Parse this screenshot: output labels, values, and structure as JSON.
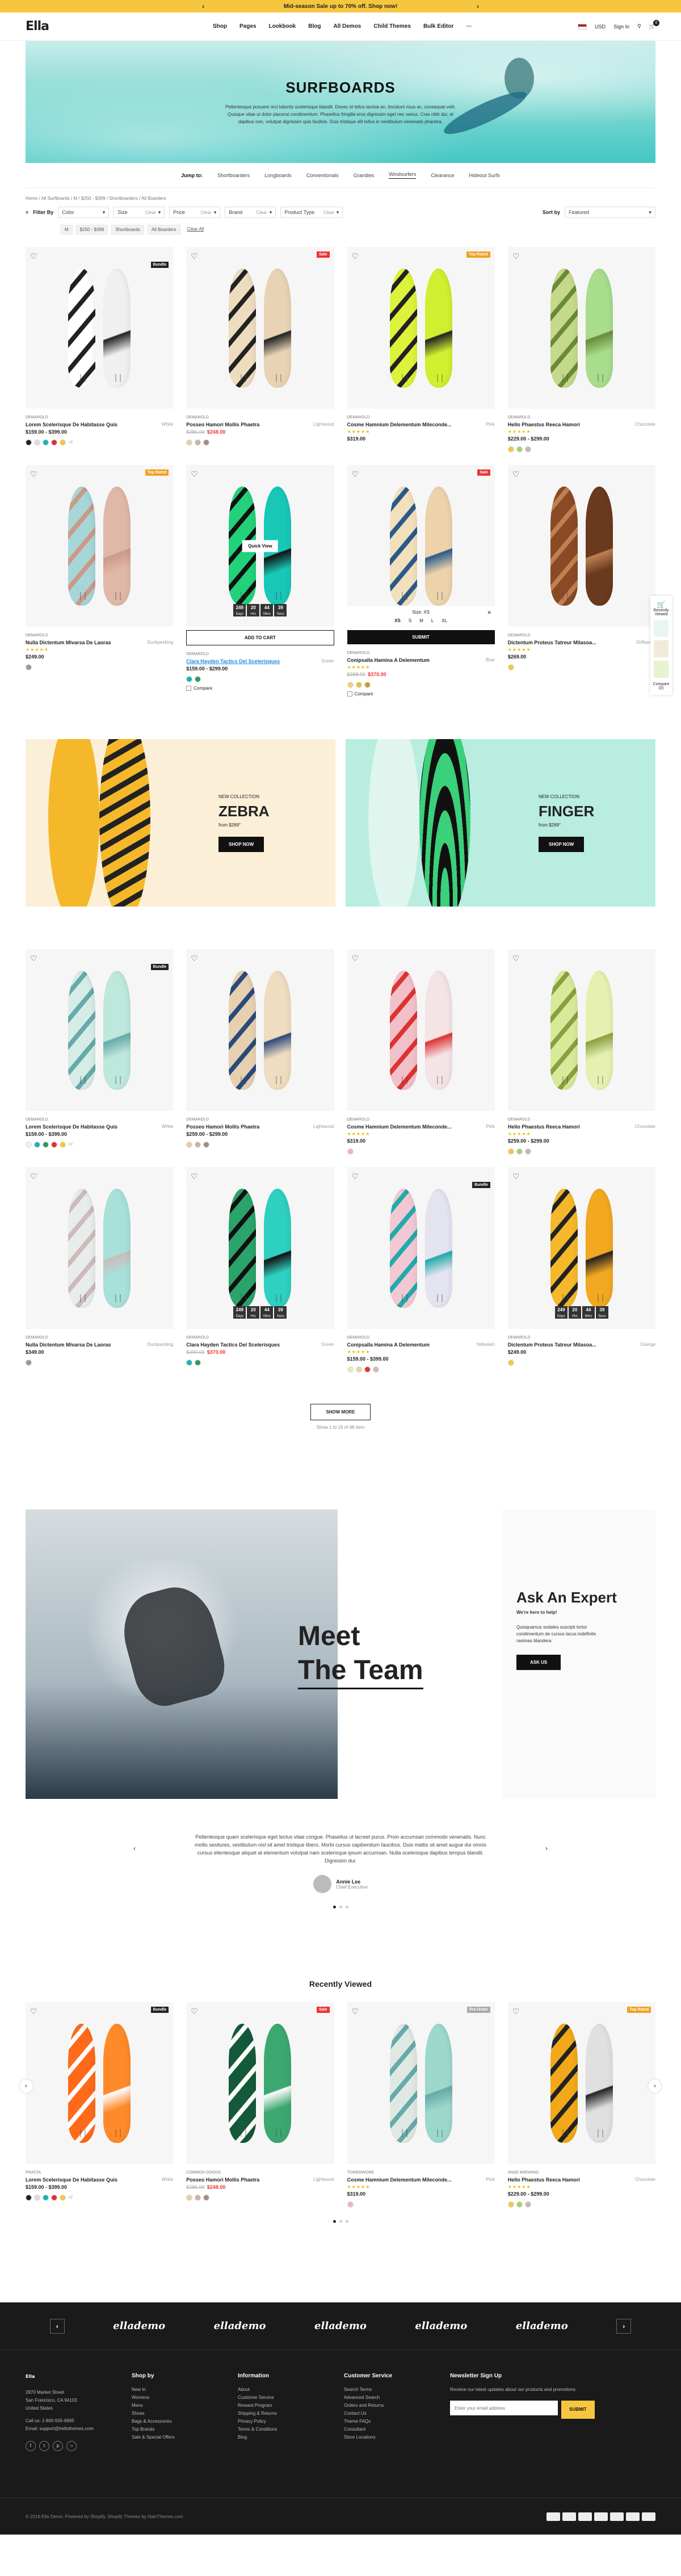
{
  "announcement": {
    "text": "Mid-season Sale up to 70% off. Shop now!"
  },
  "header": {
    "logo": "Ella",
    "nav": [
      "Shop",
      "Pages",
      "Lookbook",
      "Blog",
      "All Demos",
      "Child Themes",
      "Bulk Editor",
      "⋯"
    ],
    "currency": "USD",
    "signin": "Sign In",
    "cart_count": "0"
  },
  "hero": {
    "title": "SURFBOARDS",
    "text": "Pellentesque posuere orci lobortis scelerisque blandit. Donec id tellus lacinia an, tincidunt risus ac, consequat velit. Quisque vitae ut dolor placerat condimentum. Phasellus fringilla eros dignissim eget nec varius. Cras nibh dui, et dapibus non, volutpat dignissim quis facilisis. Duis tristique elit tellus in vestibulum venenatis pharetra."
  },
  "jump": {
    "label": "Jump to:",
    "items": [
      "Shortboarders",
      "Longboards",
      "Conventionals",
      "Grandies",
      "Windsurfers",
      "Clearance",
      "Hideout Surfs"
    ],
    "active": 4
  },
  "breadcrumb": "Home  /  All Surfboards  /  M  /  $250 - $399  /  Shortboarders  /  All Boarders",
  "filters": {
    "label": "Filter By",
    "items": [
      {
        "name": "Color",
        "val": ""
      },
      {
        "name": "Size",
        "val": "Clear"
      },
      {
        "name": "Price",
        "val": "Clear"
      },
      {
        "name": "Brand",
        "val": "Clear"
      },
      {
        "name": "Product Type",
        "val": "Clear"
      }
    ],
    "sort_label": "Sort by",
    "sort_value": "Featured"
  },
  "chips": [
    "M",
    "$250 - $399",
    "Shortboards",
    "All Boarders",
    "Clear All"
  ],
  "products": [
    {
      "vendor": "DEMAROLD",
      "title": "Lorem Scelerisque De Habitasse Quis",
      "variant": "White",
      "price": "$159.00 - $399.00",
      "old": "",
      "badge": "Bundle",
      "badge_color": "#222",
      "colors": [
        "#222",
        "#ddd",
        "#1ab3b9",
        "#d33",
        "#f6c73e"
      ],
      "more": "+2",
      "stars": "",
      "c1": "#fff",
      "c2": "#f0f0f0",
      "stripe": "#222"
    },
    {
      "vendor": "DEMAROLD",
      "title": "Posseo Hamori Mollis Phaetra",
      "variant": "Lightwood",
      "price": "$248.00",
      "old": "$286.00",
      "badge": "Sale",
      "badge_color": "#e33",
      "colors": [
        "#e5cfa8",
        "#cbb49a",
        "#a88"
      ],
      "more": "",
      "stars": "",
      "c1": "#eedcbf",
      "c2": "#e8d4b4",
      "stripe": "#222"
    },
    {
      "vendor": "DEMAROLD",
      "title": "Cosme Hamnium Delementum Mileconde...",
      "variant": "Pink",
      "price": "$319.00",
      "old": "",
      "badge": "Top Rated",
      "badge_color": "#f0a020",
      "colors": [],
      "more": "",
      "stars": "★★★★★",
      "c1": "#ddf23a",
      "c2": "#d0ef30",
      "stripe": "#222"
    },
    {
      "vendor": "DEMAROLD",
      "title": "Hello Phaestus Reeca Hamori",
      "variant": "Chocolate",
      "price": "$229.00 - $299.00",
      "old": "",
      "badge": "",
      "badge_color": "",
      "colors": [
        "#f6c73e",
        "#9ed46a",
        "#bbb"
      ],
      "more": "",
      "stars": "★★★★★",
      "c1": "#c4da8a",
      "c2": "#a7dd8c",
      "stripe": "#6a8a3a"
    },
    {
      "vendor": "DEMAROLD",
      "title": "Nulla Dictentum Mivarsa De Laoras",
      "variant": "Duckpecking",
      "price": "$249.00",
      "old": "",
      "badge": "Top Rated",
      "badge_color": "#f0a020",
      "colors": [
        "#999"
      ],
      "more": "",
      "stars": "★★★★★",
      "c1": "#a7d6d8",
      "c2": "#e0b8a8",
      "stripe": "#c98"
    },
    {
      "vendor": "DEMAROLD",
      "title": "Clara Hayden Tactics Del Scelerisques",
      "variant": "Green",
      "price": "$159.00 - $299.00",
      "old": "",
      "badge": "",
      "badge_color": "",
      "colors": [
        "#1ab3b9",
        "#2c9a5a"
      ],
      "more": "",
      "stars": "",
      "c1": "#22d27a",
      "c2": "#18c7b6",
      "stripe": "#111"
    },
    {
      "vendor": "DEMAROLD",
      "title": "Conipsalla Hamina A Delementum",
      "variant": "Blue",
      "price": "$370.00",
      "old": "$388.00",
      "badge": "Sale",
      "badge_color": "#e33",
      "colors": [
        "#f0d070",
        "#e8c040",
        "#cca030"
      ],
      "more": "",
      "stars": "★★★★★",
      "c1": "#f2e0bc",
      "c2": "#ecd3ac",
      "stripe": "#2a5a8a"
    },
    {
      "vendor": "DEMAROLD",
      "title": "Dictentum Proteus Tatreur Milasoa...",
      "variant": "Driftwood",
      "price": "$269.00",
      "old": "",
      "badge": "",
      "badge_color": "",
      "colors": [
        "#f6c73e"
      ],
      "more": "",
      "stars": "★★★★★",
      "c1": "#8a4a25",
      "c2": "#6b3a1e",
      "stripe": "#c08050"
    },
    {
      "vendor": "DEMAROLD",
      "title": "Lorem Scelerisque De Habitasse Quis",
      "variant": "White",
      "price": "$159.00 - $399.00",
      "old": "",
      "badge": "Bundle",
      "badge_color": "#222",
      "colors": [
        "#eee",
        "#1ab3b9",
        "#2c9a5a",
        "#d33",
        "#f6c73e"
      ],
      "more": "+2",
      "stars": "",
      "c1": "#d6ece6",
      "c2": "#bfe8dc",
      "stripe": "#6aa"
    },
    {
      "vendor": "DEMAROLD",
      "title": "Posseo Hamori Mollis Phaetra",
      "variant": "Lightwood",
      "price": "$259.00 - $299.00",
      "old": "",
      "badge": "",
      "badge_color": "",
      "colors": [
        "#e5cfa8",
        "#cbb49a",
        "#a88"
      ],
      "more": "",
      "stars": "",
      "c1": "#e6d0b0",
      "c2": "#f0dcc0",
      "stripe": "#2a4a7a"
    },
    {
      "vendor": "DEMAROLD",
      "title": "Cosme Hamnium Delementum Mileconde...",
      "variant": "Pink",
      "price": "$319.00",
      "old": "",
      "badge": "",
      "badge_color": "",
      "colors": [
        "#f2b0c0"
      ],
      "more": "",
      "stars": "★★★★★",
      "c1": "#f2c0c8",
      "c2": "#f4e4e6",
      "stripe": "#d33"
    },
    {
      "vendor": "DEMAROLD",
      "title": "Hello Phaestus Reeca Hamori",
      "variant": "Chocolate",
      "price": "$259.00 - $299.00",
      "old": "",
      "badge": "",
      "badge_color": "",
      "colors": [
        "#f6c73e",
        "#9ed46a",
        "#bbb"
      ],
      "more": "",
      "stars": "★★★★★",
      "c1": "#d8ea9a",
      "c2": "#e6f0b0",
      "stripe": "#8aa040"
    },
    {
      "vendor": "DEMAROLD",
      "title": "Nulla Dictentum Mivarsa De Laoras",
      "variant": "Duckpecking",
      "price": "$349.00",
      "old": "",
      "badge": "",
      "badge_color": "",
      "colors": [
        "#999"
      ],
      "more": "",
      "stars": "",
      "c1": "#e8ecea",
      "c2": "#a8e0da",
      "stripe": "#cbb"
    },
    {
      "vendor": "DEMAROLD",
      "title": "Clara Hayden Tactics Del Scelerisques",
      "variant": "Green",
      "price": "$370.00",
      "old": "$390.00",
      "badge": "",
      "badge_color": "",
      "colors": [
        "#1ab3b9",
        "#2c9a5a"
      ],
      "more": "",
      "stars": "",
      "c1": "#2aa46a",
      "c2": "#2ed0c0",
      "stripe": "#111"
    },
    {
      "vendor": "DEMAROLD",
      "title": "Conipsalla Hamina A Delementum",
      "variant": "Yellowish",
      "price": "$159.00 - $399.00",
      "old": "",
      "badge": "Bundle",
      "badge_color": "#222",
      "colors": [
        "#ece8c0",
        "#f0d0a0",
        "#d33",
        "#cbb"
      ],
      "more": "",
      "stars": "★★★★★",
      "c1": "#f2c8d4",
      "c2": "#e4e4f0",
      "stripe": "#2aa"
    },
    {
      "vendor": "DEMAROLD",
      "title": "Dictentum Proteus Tatreur Milasoa...",
      "variant": "Orange",
      "price": "$249.00",
      "old": "",
      "badge": "",
      "badge_color": "",
      "colors": [
        "#f6c73e"
      ],
      "more": "",
      "stars": "",
      "c1": "#f5b82a",
      "c2": "#f2a820",
      "stripe": "#222"
    }
  ],
  "overlay": {
    "quick": "Quick View",
    "add": "ADD TO CART",
    "size_label": "Size: XS",
    "sizes": [
      "XS",
      "S",
      "M",
      "L",
      "XL"
    ],
    "submit": "SUBMIT",
    "compare": "Compare"
  },
  "countdown": [
    {
      "n": "249",
      "u": "Days"
    },
    {
      "n": "20",
      "u": "Hrs"
    },
    {
      "n": "44",
      "u": "Mins"
    },
    {
      "n": "39",
      "u": "Secs"
    }
  ],
  "promos": [
    {
      "tag": "NEW COLLECTION",
      "title": "ZEBRA",
      "price": "from $289°",
      "btn": "SHOP NOW",
      "bg": "#fbefd8"
    },
    {
      "tag": "NEW COLLECTION",
      "title": "FINGER",
      "price": "from $289°",
      "btn": "SHOP NOW",
      "bg": "#b8ede0"
    }
  ],
  "more": {
    "btn": "SHOW MORE",
    "count": "Show 1 to 16 of 48 Item"
  },
  "team": {
    "line1": "Meet",
    "line2": "The Team",
    "ask_title": "Ask An Expert",
    "ask_sub": "We're here to help!",
    "ask_text": "Quisquamus sodales suscipit tortor condimentum de cursus lacus indefinite rasimas blandera.",
    "ask_btn": "ASK US"
  },
  "testimonial": {
    "text": "Pellentesque quam scelerisque eget lectus vitae congue. Phasellus ut lacreet purus. Proin accumsan commodo venenatis. Nunc mollis sesitures, vestibulum nisl sit amet tristique libero. Morbi cursus sapibendum faucibus. Duis mattis sit amet augue dui omnis cursus ellentesque aliquet at elementum volutpat nam scelerisque ipsum accumsan. Nulla scelerisque dapibus tempus blandit. Dignissim dui.",
    "name": "Annie Lee",
    "role": "Chief Executive"
  },
  "recent": {
    "title": "Recently Viewed",
    "items": [
      {
        "vendor": "PRATZA",
        "title": "Lorem Scelerisque De Habitasse Quis",
        "variant": "White",
        "price": "$159.00 - $399.00",
        "old": "",
        "badge": "Bundle",
        "badge_color": "#222",
        "colors": [
          "#222",
          "#ddd",
          "#1ab3b9",
          "#d33",
          "#f6c73e"
        ],
        "more": "+2",
        "stars": "",
        "c1": "#ff6a1a",
        "c2": "#ff8a2a",
        "stripe": "#fff"
      },
      {
        "vendor": "COMMON GOODS",
        "title": "Posseo Hamori Mollis Phaetra",
        "variant": "Lightwood",
        "price": "$248.00",
        "old": "$286.00",
        "badge": "Sale",
        "badge_color": "#e33",
        "colors": [
          "#e5cfa8",
          "#cbb49a",
          "#a88"
        ],
        "more": "",
        "stars": "",
        "c1": "#145a3a",
        "c2": "#3ca870",
        "stripe": "#fff"
      },
      {
        "vendor": "TOWERWORK",
        "title": "Cosme Hamnium Delementum Mileconde...",
        "variant": "Pink",
        "price": "$319.00",
        "old": "",
        "badge": "Pre-Order",
        "badge_color": "#aaa",
        "colors": [
          "#f2b0c0"
        ],
        "more": "",
        "stars": "★★★★★",
        "c1": "#e0e8e4",
        "c2": "#9cd8cc",
        "stripe": "#6aa"
      },
      {
        "vendor": "ANSE BREWING",
        "title": "Hello Phaestus Reeca Hamori",
        "variant": "Chocolate",
        "price": "$229.00 - $299.00",
        "old": "",
        "badge": "Top Rated",
        "badge_color": "#f0a020",
        "colors": [
          "#f6c73e",
          "#9ed46a",
          "#bbb"
        ],
        "more": "",
        "stars": "★★★★★",
        "c1": "#f2a818",
        "c2": "#e0e0e0",
        "stripe": "#222"
      }
    ]
  },
  "brands": [
    "ellademo",
    "ellademo",
    "ellademo",
    "ellademo",
    "ellademo"
  ],
  "footer": {
    "logo": "Ella",
    "address": "2870 Market Street\nSan Francisco, CA 94103\nUnited States",
    "phone": "Call us: 1-800-555-6695",
    "email": "Email: support@hellothemes.com",
    "cols": [
      {
        "title": "Shop by",
        "links": [
          "New In",
          "Womens",
          "Mens",
          "Shoes",
          "Bags & Accessories",
          "Top Brands",
          "Sale & Special Offers"
        ]
      },
      {
        "title": "Information",
        "links": [
          "About",
          "Customer Service",
          "Reward Program",
          "Shipping & Returns",
          "Privacy Policy",
          "Terms & Conditions",
          "Blog"
        ]
      },
      {
        "title": "Customer Service",
        "links": [
          "Search Terms",
          "Advanced Search",
          "Orders and Returns",
          "Contact Us",
          "Theme FAQs",
          "Consultant",
          "Store Locations"
        ]
      }
    ],
    "news_title": "Newsletter Sign Up",
    "news_text": "Receive our latest updates about our products and promotions.",
    "news_placeholder": "Enter your email address",
    "news_btn": "SUBMIT",
    "copyright": "© 2018 Ella Demo. Powered by Shopify. Shopify Themes by HaloThemes.com"
  },
  "sidebar": {
    "label": "Recently Viewed",
    "compare": "Compare (0)"
  }
}
